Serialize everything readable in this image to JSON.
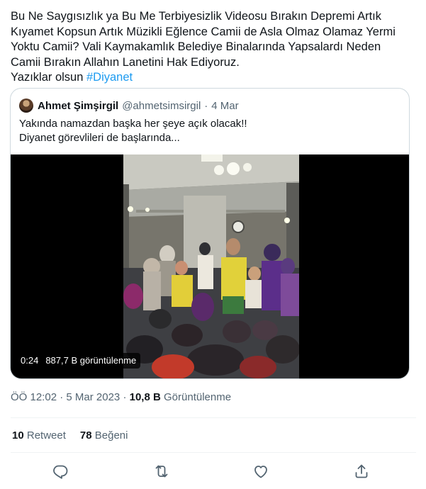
{
  "tweet": {
    "text": "Bu Ne Saygısızlık ya Bu Me Terbiyesizlik Videosu Bırakın Depremi Artık\nKıyamet Kopsun Artık Müzikli Eğlence Camii de Asla Olmaz Olamaz Yermi\nYoktu Camii? Vali Kaymakamlık Belediye Binalarında Yapsalardı Neden\nCamii Bırakın Allahın Lanetini Hak Ediyoruz.\nYazıklar olsun ",
    "hashtag": "#Diyanet"
  },
  "quote": {
    "author_name": "Ahmet Şimşirgil",
    "handle": "@ahmetsimsirgil",
    "separator": "·",
    "date": "4 Mar",
    "text": "Yakında namazdan başka her şeye açık olacak!!\nDiyanet görevlileri de başlarında...",
    "video": {
      "duration": "0:24",
      "views": "887,7 B görüntülenme"
    }
  },
  "meta": {
    "time": "ÖÖ 12:02",
    "separator": "·",
    "date": "5 Mar 2023",
    "views_count": "10,8 B",
    "views_label": "Görüntülenme"
  },
  "stats": {
    "retweets": "10",
    "retweets_label": "Retweet",
    "likes": "78",
    "likes_label": "Beğeni"
  },
  "actions": [
    {
      "name": "reply",
      "icon": "reply-icon"
    },
    {
      "name": "retweet",
      "icon": "retweet-icon"
    },
    {
      "name": "like",
      "icon": "heart-icon"
    },
    {
      "name": "share",
      "icon": "share-icon"
    }
  ],
  "colors": {
    "accent": "#1d9bf0",
    "text": "#0f1419",
    "secondary": "#536471",
    "border": "#cfd9de"
  }
}
